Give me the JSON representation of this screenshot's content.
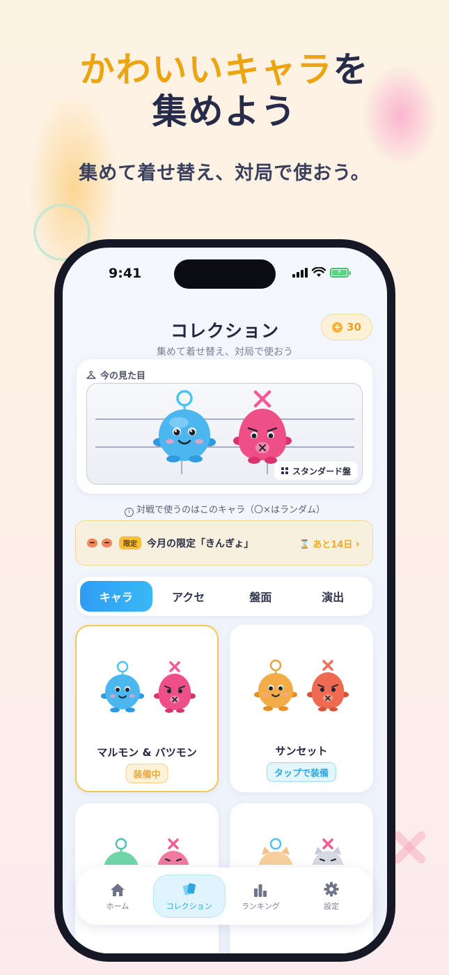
{
  "hero": {
    "title_accent": "かわいいキャラ",
    "title_rest_1": "を",
    "title_line_2": "集めよう",
    "subtitle": "集めて着せ替え、対局で使おう。"
  },
  "status_bar": {
    "time": "9:41"
  },
  "header": {
    "title": "コレクション",
    "subtitle": "集めて着せ替え、対局で使おう",
    "coins": "30"
  },
  "current_look": {
    "label": "今の見た目",
    "board_name": "スタンダード盤"
  },
  "note": "対戦で使うのはこのキャラ（〇×はランダム）",
  "promo": {
    "badge": "限定",
    "text": "今月の限定「きんぎょ」",
    "remaining": "あと14日",
    "chevron": "›"
  },
  "tabs": [
    {
      "label": "キャラ",
      "active": true
    },
    {
      "label": "アクセ",
      "active": false
    },
    {
      "label": "盤面",
      "active": false
    },
    {
      "label": "演出",
      "active": false
    }
  ],
  "characters": [
    {
      "name": "マルモン & バツモン",
      "tag": "装備中",
      "state": "equipped"
    },
    {
      "name": "サンセット",
      "tag": "タップで装備",
      "state": "available"
    },
    {
      "name": "",
      "tag": "",
      "state": "partial"
    },
    {
      "name": "",
      "tag": "",
      "state": "partial"
    }
  ],
  "tabbar": [
    {
      "label": "ホーム",
      "icon": "home-icon",
      "active": false
    },
    {
      "label": "コレクション",
      "icon": "cards-icon",
      "active": true
    },
    {
      "label": "ランキング",
      "icon": "bar-chart-icon",
      "active": false
    },
    {
      "label": "設定",
      "icon": "gear-icon",
      "active": false
    }
  ],
  "colors": {
    "accent_yellow": "#eba511",
    "tab_active_blue": "#2f9cf5",
    "maru_blue": "#4cb6ef",
    "batsu_pink": "#ee4f86",
    "sunset_orange": "#f3ad48",
    "sunset_red": "#ee6a50",
    "equipped_gold": "#f4c84c"
  }
}
